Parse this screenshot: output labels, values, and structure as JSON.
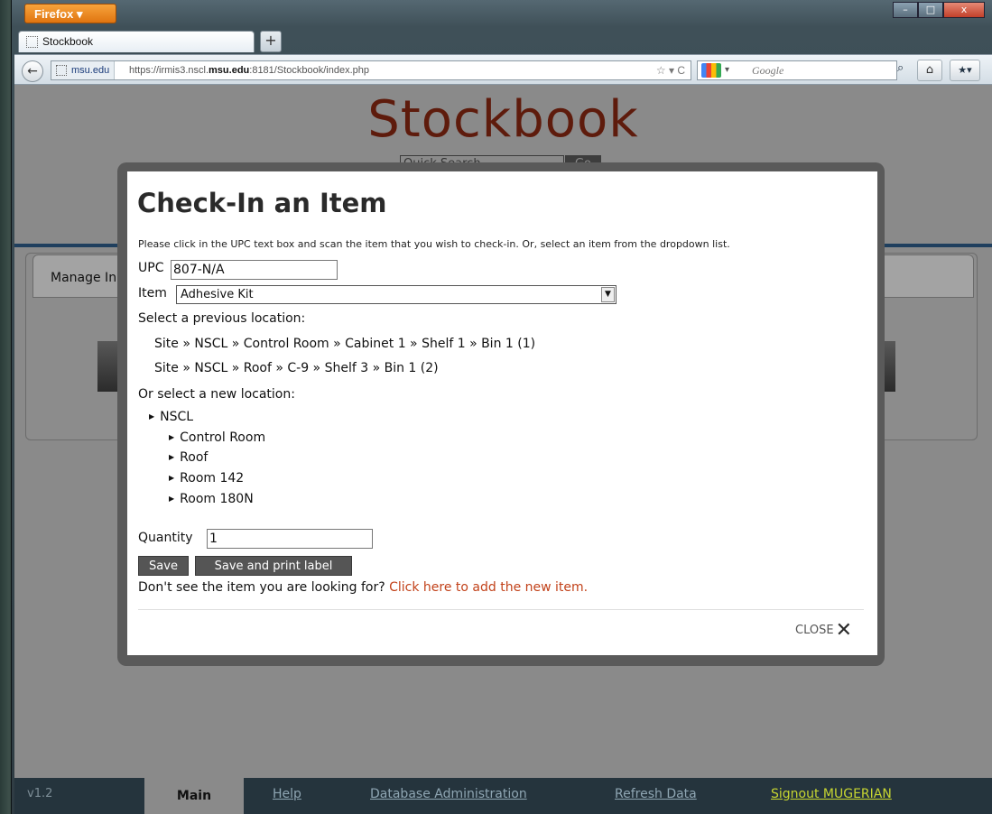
{
  "browser": {
    "menu_label": "Firefox ▾",
    "window_controls": [
      "–",
      "□",
      "x"
    ],
    "tab_title": "Stockbook",
    "new_tab": "+",
    "identity": "msu.edu",
    "url_prefix": "https://irmis3.nscl.",
    "url_domain": "msu.edu",
    "url_suffix": ":8181/Stockbook/index.php",
    "url_icons": "☆ ▾ C",
    "search_placeholder": "Google",
    "search_icon": "magnifier-icon",
    "home_icon": "home-icon",
    "bookmarks_icon": "bookmarks-icon"
  },
  "site": {
    "title": "Stockbook",
    "quick_search_placeholder": "Quick Search",
    "go_label": "Go",
    "background_tab_label": "Manage In"
  },
  "modal": {
    "title": "Check-In an Item",
    "instructions": "Please click in the UPC text box and scan the item that you wish to check-in. Or, select an item from the dropdown list.",
    "upc_label": "UPC",
    "upc_value": "807-N/A",
    "item_label": "Item",
    "item_value": "Adhesive Kit",
    "previous_location_label": "Select a previous location:",
    "previous_locations": [
      "Site » NSCL » Control Room » Cabinet 1 » Shelf 1 » Bin 1 (1)",
      "Site » NSCL » Roof » C-9 » Shelf 3 » Bin 1 (2)"
    ],
    "new_location_label": "Or select a new location:",
    "tree": {
      "root": "NSCL",
      "children": [
        "Control Room",
        "Roof",
        "Room 142",
        "Room 180N"
      ]
    },
    "quantity_label": "Quantity",
    "quantity_value": "1",
    "save_label": "Save",
    "save_print_label": "Save and print label",
    "add_prompt": "Don't see the item you are looking for?",
    "add_link": "Click here to add the new item.",
    "close_label": "CLOSE",
    "close_icon": "✕"
  },
  "footer": {
    "version": "v1.2",
    "nav": [
      "Main",
      "Help",
      "Database Administration",
      "Refresh Data",
      "Signout MUGERIAN"
    ]
  },
  "colors": {
    "title": "#5e1b0c",
    "link_accent": "#c2421a",
    "signout": "#c7d631",
    "footer_bg": "#25343d"
  }
}
